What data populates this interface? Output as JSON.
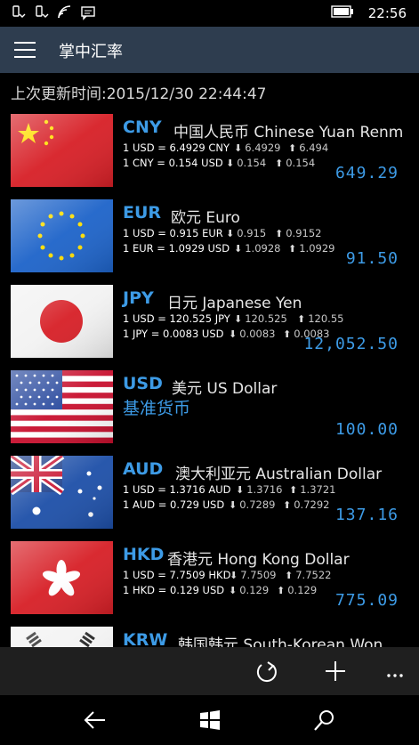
{
  "status": {
    "time": "22:56"
  },
  "app": {
    "title": "掌中汇率"
  },
  "updated": "上次更新时间:2015/12/30 22:44:47",
  "currencies": [
    {
      "code": "CNY",
      "name": "中国人民币 Chinese Yuan Renm",
      "line1": "1 USD = 6.4929 CNY",
      "l1_low": "6.4929",
      "l1_high": "6.494",
      "line2": "1 CNY = 0.154 USD",
      "l2_low": "0.154",
      "l2_high": "0.154",
      "amount": "649.29",
      "flag": "cn"
    },
    {
      "code": "EUR",
      "name": "欧元 Euro",
      "line1": "1 USD = 0.915 EUR",
      "l1_low": "0.915",
      "l1_high": "0.9152",
      "line2": "1 EUR = 1.0929 USD",
      "l2_low": "1.0928",
      "l2_high": "1.0929",
      "amount": "91.50",
      "flag": "eu"
    },
    {
      "code": "JPY",
      "name": "日元 Japanese Yen",
      "line1": "1 USD = 120.525 JPY",
      "l1_low": "120.525",
      "l1_high": "120.55",
      "line2": "1 JPY = 0.0083 USD",
      "l2_low": "0.0083",
      "l2_high": "0.0083",
      "amount": "12,052.50",
      "flag": "jp"
    },
    {
      "code": "USD",
      "name": "美元 US Dollar",
      "base_label": "基准货币",
      "amount": "100.00",
      "flag": "us"
    },
    {
      "code": "AUD",
      "name": "澳大利亚元 Australian Dollar",
      "line1": "1 USD = 1.3716 AUD",
      "l1_low": "1.3716",
      "l1_high": "1.3721",
      "line2": "1 AUD = 0.729 USD",
      "l2_low": "0.7289",
      "l2_high": "0.7292",
      "amount": "137.16",
      "flag": "au"
    },
    {
      "code": "HKD",
      "name": "香港元 Hong Kong Dollar",
      "line1": "1 USD = 7.7509 HKD",
      "l1_low": "7.7509",
      "l1_high": "7.7522",
      "line2": "1 HKD = 0.129 USD",
      "l2_low": "0.129",
      "l2_high": "0.129",
      "amount": "775.09",
      "flag": "hk"
    },
    {
      "code": "KRW",
      "name": "韩国韩元 South-Korean Won",
      "flag": "kr"
    }
  ],
  "icons": {
    "refresh": "refresh-icon",
    "add": "add-icon",
    "more": "more-icon",
    "back": "back-icon",
    "windows": "windows-icon",
    "search": "search-icon"
  }
}
